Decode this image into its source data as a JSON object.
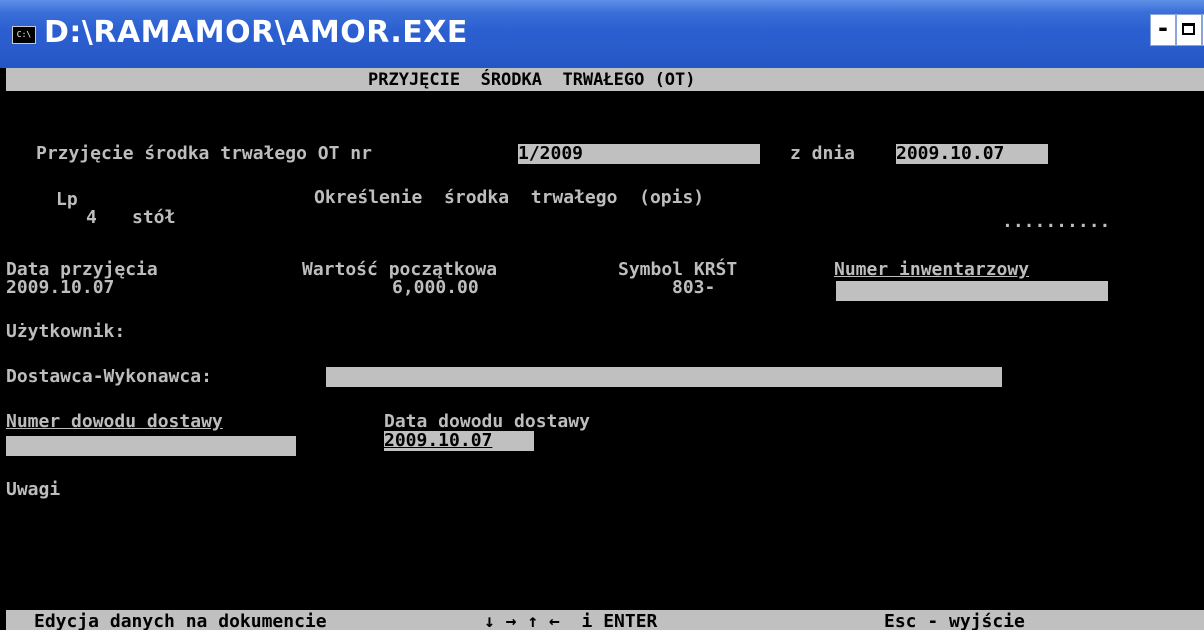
{
  "window": {
    "title": "D:\\RAMAMOR\\AMOR.EXE",
    "icon_label": "C:\\",
    "controls": {
      "minimize": "-",
      "maximize": "",
      "close": "×"
    }
  },
  "header": "PRZYJĘCIE  ŚRODKA  TRWAŁEGO (OT)",
  "doc_line": {
    "label": "Przyjęcie środka trwałego OT nr",
    "number": "1/2009",
    "date_label": "z dnia",
    "date": "2009.10.07"
  },
  "item": {
    "lp_label": "Lp",
    "desc_label": "Określenie  środka  trwałego  (opis)",
    "lp_value": "4",
    "desc_value": "stół",
    "dots": ".........."
  },
  "details": {
    "data_przyjecia_label": "Data przyjęcia",
    "data_przyjecia": "2009.10.07",
    "wartosc_label": "Wartość początkowa",
    "wartosc": "6,000.00",
    "symbol_label": "Symbol KRŚT",
    "symbol": "803-",
    "numer_inw_label": "Numer inwentarzowy",
    "numer_inw": ""
  },
  "uzytkownik_label": "Użytkownik:",
  "dostawca_label": "Dostawca-Wykonawca:",
  "dostawca": "",
  "dowod": {
    "numer_label": "Numer dowodu dostawy",
    "numer": "",
    "data_label": "Data dowodu dostawy",
    "data": "2009.10.07"
  },
  "uwagi_label": "Uwagi",
  "footer": {
    "left": "Edycja danych na dokumencie",
    "keys": "↓ → ↑ ←  i ENTER",
    "right": "Esc - wyjście"
  }
}
